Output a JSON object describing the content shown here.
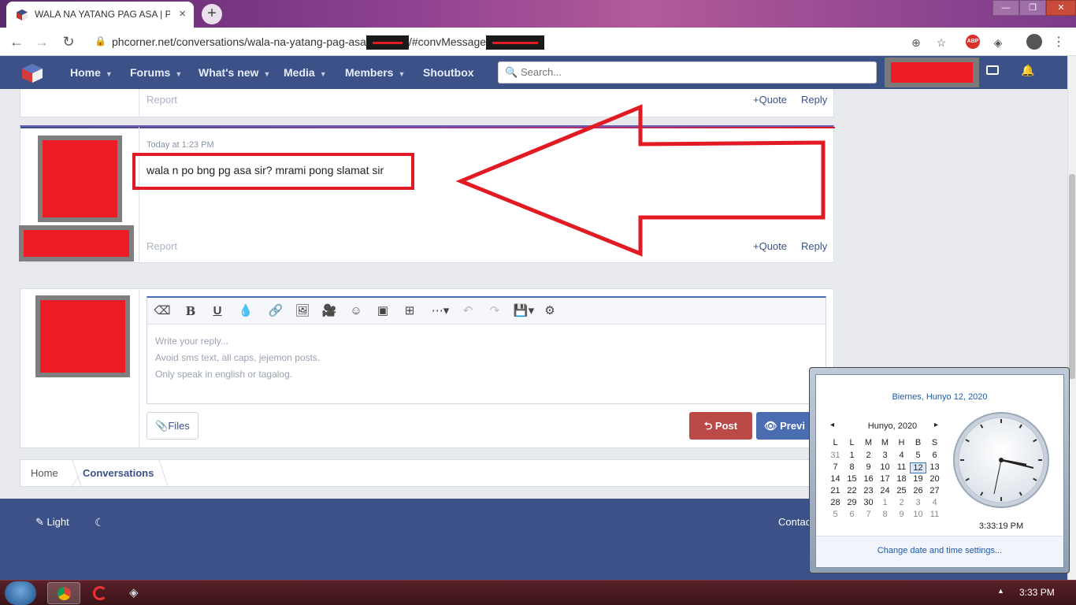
{
  "browser": {
    "tab_title": "WALA NA YATANG PAG ASA | PHCorner",
    "tab_close": "×",
    "new_tab": "+",
    "window_buttons": {
      "minimize": "—",
      "maximize": "❐",
      "close": "✕"
    },
    "url_prefix": "phcorner.net/conversations/wala-na-yatang-pag-asa",
    "url_middle": "/#convMessage",
    "extension_abp": "ABP"
  },
  "site": {
    "nav": [
      {
        "label": "Home"
      },
      {
        "label": "Forums"
      },
      {
        "label": "What's new"
      },
      {
        "label": "Members"
      },
      {
        "label": "Media"
      },
      {
        "label": "Shoutbox"
      }
    ],
    "search_placeholder": "Search..."
  },
  "prev_message": {
    "report": "Report",
    "quote": "Quote",
    "reply": "Reply"
  },
  "message": {
    "timestamp": "Today at 1:23 PM",
    "text": "wala n po bng pg asa sir? mrami pong slamat sir",
    "report": "Report",
    "quote": "Quote",
    "reply": "Reply"
  },
  "editor": {
    "placeholder_lines": [
      "Write your reply...",
      "Avoid sms text, all caps, jejemon posts.",
      "Only speak in english or tagalog."
    ],
    "files_label": "Files",
    "post_label": "Post",
    "preview_label": "Previ"
  },
  "breadcrumb": [
    {
      "label": "Home"
    },
    {
      "label": "Conversations"
    }
  ],
  "footer": {
    "light_label": "Light",
    "contact_label": "Contac"
  },
  "calendar": {
    "full_date": "Biernes, Hunyo 12, 2020",
    "month_label": "Hunyo, 2020",
    "prev": "◂",
    "next": "▸",
    "weekdays": [
      "L",
      "L",
      "M",
      "M",
      "H",
      "B",
      "S"
    ],
    "weeks": [
      [
        "31",
        "1",
        "2",
        "3",
        "4",
        "5",
        "6"
      ],
      [
        "7",
        "8",
        "9",
        "10",
        "11",
        "12",
        "13"
      ],
      [
        "14",
        "15",
        "16",
        "17",
        "18",
        "19",
        "20"
      ],
      [
        "21",
        "22",
        "23",
        "24",
        "25",
        "26",
        "27"
      ],
      [
        "28",
        "29",
        "30",
        "1",
        "2",
        "3",
        "4"
      ],
      [
        "5",
        "6",
        "7",
        "8",
        "9",
        "10",
        "11"
      ]
    ],
    "today": "12",
    "time": "3:33:19 PM",
    "change_settings": "Change date and time settings..."
  },
  "taskbar": {
    "clock": "3:33 PM",
    "tray_arrow": "▲"
  },
  "colors": {
    "header_blue": "#3b5188",
    "accent_red": "#e21a24",
    "post_button": "#b94a48",
    "preview_button": "#4a6cb0"
  }
}
